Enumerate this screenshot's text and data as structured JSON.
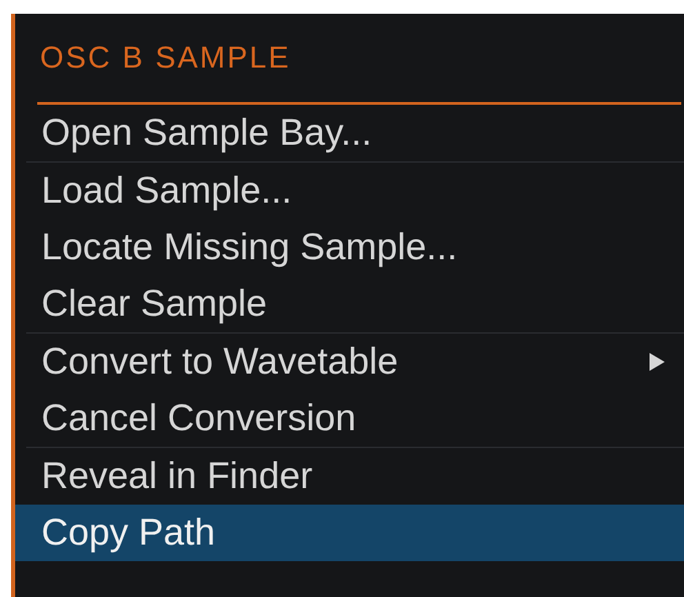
{
  "menu": {
    "title": "OSC B SAMPLE",
    "sections": [
      {
        "items": [
          {
            "label": "Open Sample Bay...",
            "selected": false,
            "submenu": false
          }
        ]
      },
      {
        "items": [
          {
            "label": "Load Sample...",
            "selected": false,
            "submenu": false
          },
          {
            "label": "Locate Missing Sample...",
            "selected": false,
            "submenu": false
          },
          {
            "label": "Clear Sample",
            "selected": false,
            "submenu": false
          }
        ]
      },
      {
        "items": [
          {
            "label": "Convert to Wavetable",
            "selected": false,
            "submenu": true
          },
          {
            "label": "Cancel Conversion",
            "selected": false,
            "submenu": false
          }
        ]
      },
      {
        "items": [
          {
            "label": "Reveal in Finder",
            "selected": false,
            "submenu": false
          },
          {
            "label": "Copy Path",
            "selected": true,
            "submenu": false
          }
        ]
      }
    ]
  }
}
